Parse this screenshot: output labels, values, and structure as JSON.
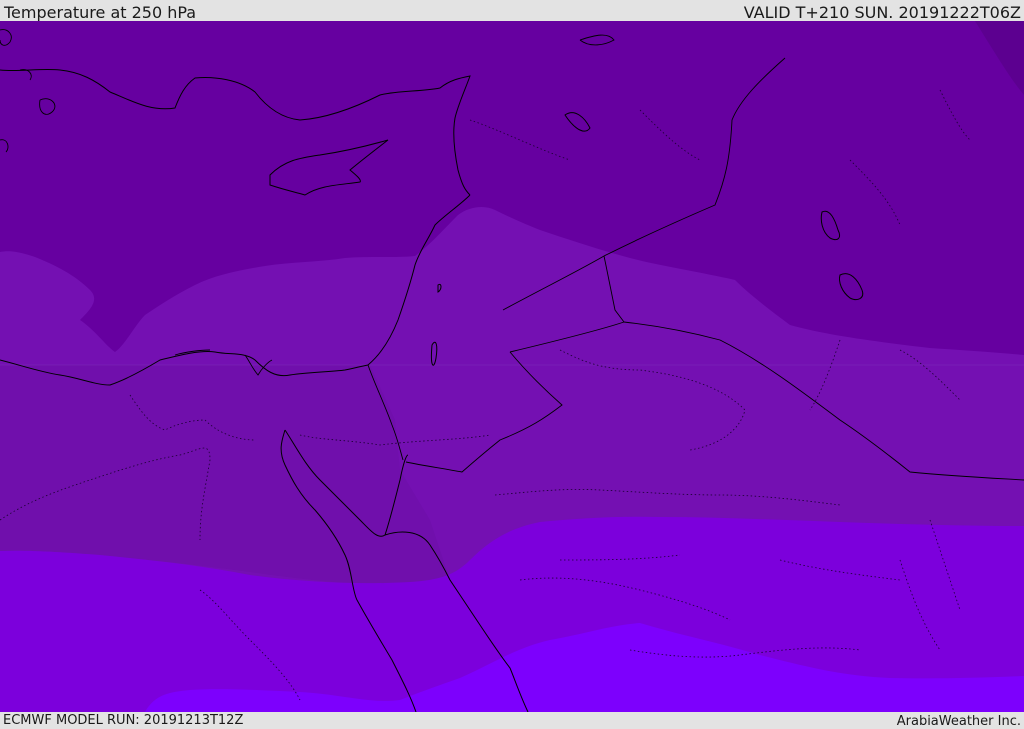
{
  "header": {
    "title": "Temperature at 250 hPa",
    "valid_time": "VALID T+210 SUN. 20191222T06Z"
  },
  "footer": {
    "model_run": "ECMWF MODEL RUN: 20191213T12Z",
    "credit": "ArabiaWeather Inc."
  },
  "map": {
    "region": "Eastern Mediterranean / Levant",
    "field": "temperature-250hPa",
    "fill_colors": [
      "#5c0090",
      "#6600a0",
      "#7410b2",
      "#700fac",
      "#7c00dc",
      "#7d00fd"
    ],
    "coastline_color": "#000000",
    "border_style": "solid",
    "internal_border_style": "dotted"
  }
}
